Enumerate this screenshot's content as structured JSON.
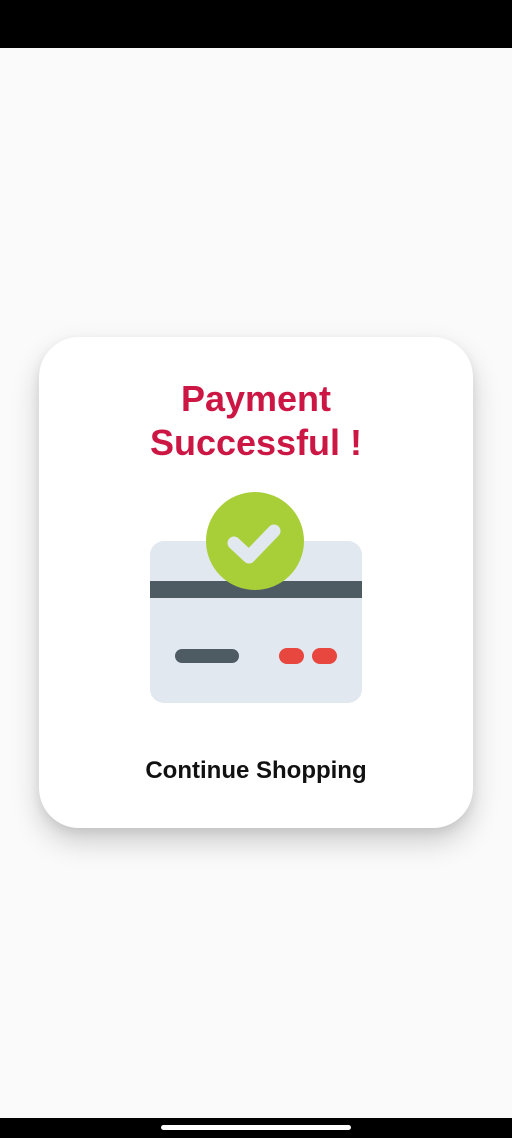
{
  "dialog": {
    "title_line1": "Payment",
    "title_line2": "Successful !",
    "continue_label": "Continue Shopping"
  },
  "illustration": {
    "card_icon": "credit-card-icon",
    "check_icon": "check-circle-icon"
  },
  "colors": {
    "title": "#cc1745",
    "check_badge": "#a8cf38",
    "card_body": "#e1e8f0",
    "card_stripe": "#4f5b62",
    "card_dots": "#e8473f"
  }
}
